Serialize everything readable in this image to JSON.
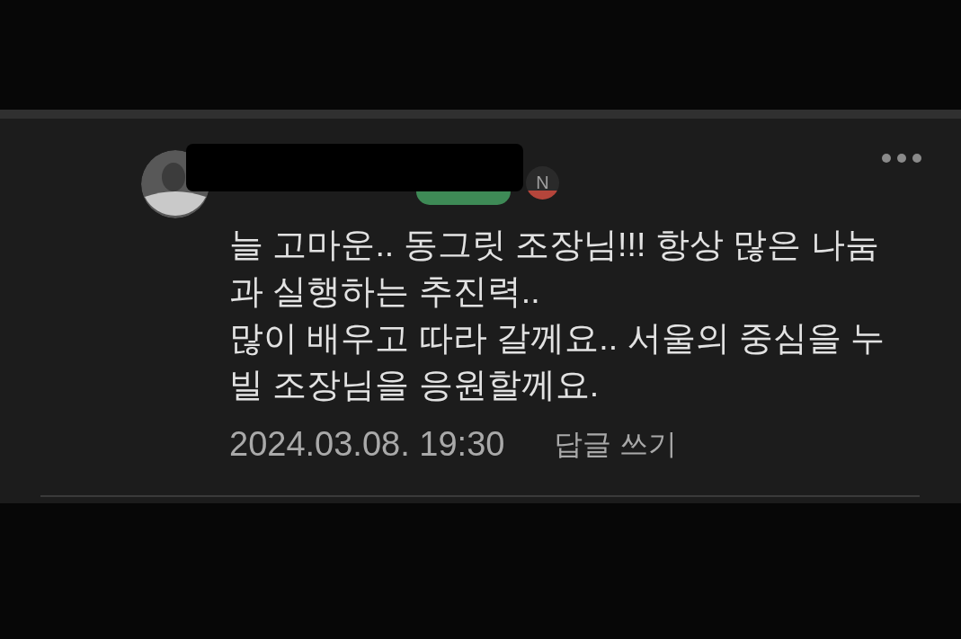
{
  "comment": {
    "new_badge": "N",
    "text": "늘 고마운.. 동그릿 조장님!!! 항상 많은 나눔과 실행하는 추진력..\n많이 배우고 따라 갈께요.. 서울의 중심을 누빌 조장님을 응원할께요.",
    "date": "2024.03.08. 19:30",
    "reply_label": "답글 쓰기"
  }
}
